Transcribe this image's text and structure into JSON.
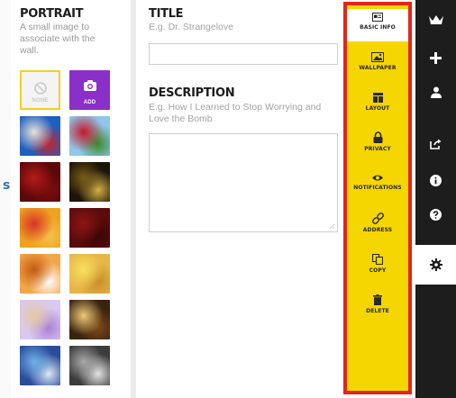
{
  "portrait": {
    "title": "PORTRAIT",
    "hint": "A small image to associate with the wall.",
    "none_label": "NONE",
    "add_label": "ADD",
    "thumbnails": [
      {
        "name": "thumb-colorful-collage",
        "colors": [
          "#1f5fc0",
          "#e8e0d8",
          "#c2242a"
        ]
      },
      {
        "name": "thumb-soccer-player",
        "colors": [
          "#8fc7ea",
          "#c8162a",
          "#3a8a2c"
        ]
      },
      {
        "name": "thumb-red-rose",
        "colors": [
          "#5a0808",
          "#b71b1b",
          "#7a0d0d"
        ]
      },
      {
        "name": "thumb-golden-lights",
        "colors": [
          "#1b1408",
          "#7a5d1a",
          "#d8b347"
        ]
      },
      {
        "name": "thumb-origami-bird",
        "colors": [
          "#f0a21e",
          "#d8332a",
          "#f6c24a"
        ]
      },
      {
        "name": "thumb-red-texture",
        "colors": [
          "#5a0b0b",
          "#8c1515",
          "#3b0606"
        ]
      },
      {
        "name": "thumb-orange-notepad",
        "colors": [
          "#f2a64a",
          "#c45a12",
          "#ffffff"
        ]
      },
      {
        "name": "thumb-sticky-note",
        "colors": [
          "#e8b548",
          "#f6e15e",
          "#c98d2a"
        ]
      },
      {
        "name": "thumb-birthday-cake",
        "colors": [
          "#d8c9f2",
          "#e6c9a4",
          "#a97ed6"
        ]
      },
      {
        "name": "thumb-candles",
        "colors": [
          "#3a2410",
          "#f0c878",
          "#7a4a18"
        ]
      },
      {
        "name": "thumb-globe",
        "colors": [
          "#2a4c9a",
          "#6fb0e8",
          "#dfe9f6"
        ]
      },
      {
        "name": "thumb-gray-sphere",
        "colors": [
          "#3c3c3c",
          "#a8a8a8",
          "#e6e6e6"
        ]
      }
    ]
  },
  "form": {
    "title_label": "TITLE",
    "title_placeholder": "E.g. Dr. Strangelove",
    "description_label": "DESCRIPTION",
    "description_placeholder": "E.g. How I Learned to Stop Worrying and Love the Bomb"
  },
  "settings_menu": {
    "items": [
      {
        "label": "BASIC INFO",
        "icon": "basic-info-icon",
        "active": true
      },
      {
        "label": "WALLPAPER",
        "icon": "wallpaper-icon"
      },
      {
        "label": "LAYOUT",
        "icon": "layout-icon"
      },
      {
        "label": "PRIVACY",
        "icon": "lock-icon"
      },
      {
        "label": "NOTIFICATIONS",
        "icon": "eye-icon"
      },
      {
        "label": "ADDRESS",
        "icon": "link-icon"
      },
      {
        "label": "COPY",
        "icon": "copy-icon"
      },
      {
        "label": "DELETE",
        "icon": "trash-icon"
      }
    ],
    "highlight_color": "#e32619",
    "panel_color": "#f6d600"
  },
  "sidebar": {
    "icons": [
      "crown-logo-icon",
      "plus-icon",
      "user-icon",
      "share-icon",
      "info-icon",
      "help-icon",
      "gear-icon"
    ]
  },
  "left_edge_glyph": "s"
}
